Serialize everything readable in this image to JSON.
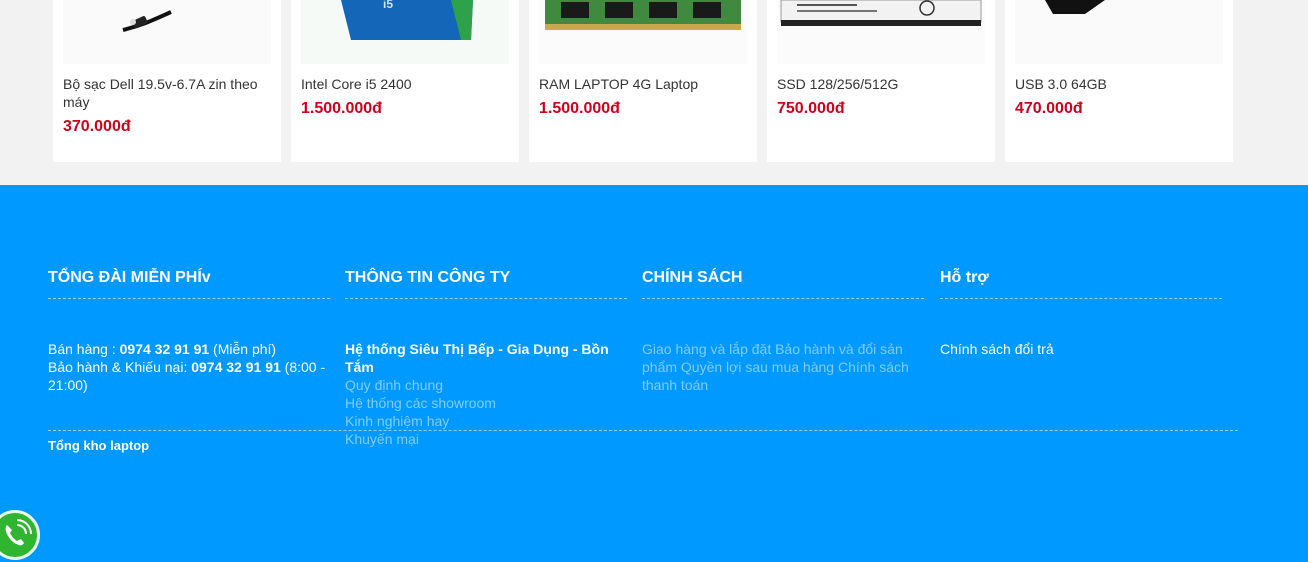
{
  "products": [
    {
      "name": "Bộ sạc Dell 19.5v-6.7A zin theo máy",
      "price": "370.000đ",
      "image_icon": "charger-image"
    },
    {
      "name": "Intel Core i5 2400",
      "price": "1.500.000đ",
      "image_icon": "cpu-box-image"
    },
    {
      "name": "RAM LAPTOP 4G Laptop",
      "price": "1.500.000đ",
      "image_icon": "ram-module-image"
    },
    {
      "name": "SSD 128/256/512G",
      "price": "750.000đ",
      "image_icon": "ssd-image"
    },
    {
      "name": "USB 3.0 64GB",
      "price": "470.000đ",
      "image_icon": "usb-image"
    }
  ],
  "footer": {
    "hotline": {
      "title": "TỔNG ĐÀI MIỄN PHÍv",
      "sales_label": "Bán hàng : ",
      "sales_phone": "0974 32 91 91",
      "sales_note": " (Miễn phí)",
      "warranty_label": "Bảo hành & Khiếu nại: ",
      "warranty_phone": "0974 32 91 91",
      "warranty_note": " (8:00 - 21:00)"
    },
    "company": {
      "title": "THÔNG TIN CÔNG TY",
      "links": [
        "Hệ thống Siêu Thị Bếp - Gia Dụng - Bồn Tắm",
        "Quy định chung",
        "Hệ thống các showroom",
        "Kinh nghiệm hay",
        "Khuyến mại"
      ]
    },
    "policy": {
      "title": "CHÍNH SÁCH",
      "text": "Giao hàng và lắp đặt Bảo hành và đổi sản phẩm Quyền lợi sau mua hàng Chính sách thanh toán"
    },
    "support": {
      "title": "Hỗ trợ",
      "links": [
        "Chính sách đổi trả"
      ]
    },
    "warehouse": "Tổng kho laptop"
  },
  "colors": {
    "footer_bg": "#0099ff",
    "price": "#d0021b",
    "call_button": "#2fb52f"
  },
  "call_icon": "phone-icon"
}
